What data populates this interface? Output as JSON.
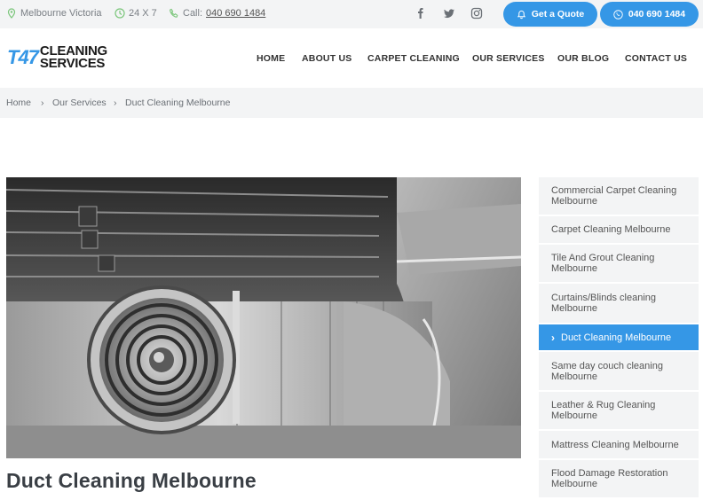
{
  "topbar": {
    "location": "Melbourne Victoria",
    "hours": "24 X 7",
    "call_label": "Call:",
    "call_number": "040 690 1484",
    "social_icons": [
      "facebook-icon",
      "twitter-icon",
      "instagram-icon"
    ],
    "quote_button": "Get a Quote",
    "phone_button": "040 690 1484"
  },
  "logo": {
    "mark": "T47",
    "line1": "CLEANING",
    "line2": "SERVICES"
  },
  "nav": [
    {
      "label": "HOME"
    },
    {
      "label": "ABOUT US"
    },
    {
      "label": "CARPET CLEANING"
    },
    {
      "label": "OUR SERVICES"
    },
    {
      "label": "OUR BLOG"
    },
    {
      "label": "CONTACT US"
    }
  ],
  "breadcrumb": [
    {
      "label": "Home"
    },
    {
      "label": "Our Services"
    },
    {
      "label": "Duct Cleaning Melbourne"
    }
  ],
  "breadcrumb_separator": "›",
  "page_title": "Duct Cleaning Melbourne",
  "side_menu": [
    {
      "label": "Commercial Carpet Cleaning Melbourne",
      "active": false
    },
    {
      "label": "Carpet Cleaning Melbourne",
      "active": false
    },
    {
      "label": "Tile And Grout Cleaning Melbourne",
      "active": false
    },
    {
      "label": "Curtains/Blinds cleaning Melbourne",
      "active": false
    },
    {
      "label": "Duct Cleaning Melbourne",
      "active": true
    },
    {
      "label": "Same day couch cleaning Melbourne",
      "active": false
    },
    {
      "label": "Leather & Rug Cleaning Melbourne",
      "active": false
    },
    {
      "label": "Mattress Cleaning Melbourne",
      "active": false
    },
    {
      "label": "Flood Damage Restoration Melbourne",
      "active": false
    }
  ],
  "colors": {
    "accent": "#3597e6",
    "icon_green": "#7bc67b",
    "light_bg": "#f3f4f5"
  }
}
